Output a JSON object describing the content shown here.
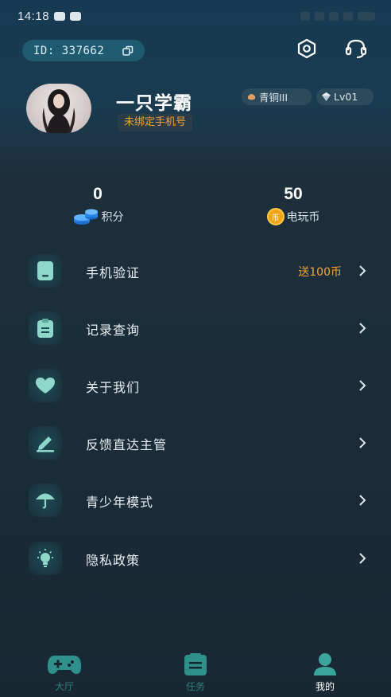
{
  "status_bar": {
    "time": "14:18"
  },
  "header": {
    "id_label": "ID: 337662"
  },
  "profile": {
    "username": "一只学霸",
    "phone_status": "未绑定手机号",
    "rank": "青铜III",
    "level": "Lv01"
  },
  "stats": {
    "points": {
      "value": "0",
      "label": "积分"
    },
    "coins": {
      "value": "50",
      "label": "电玩币",
      "coin_glyph": "币"
    }
  },
  "menu": [
    {
      "label": "手机验证",
      "note": "送100币",
      "icon": "phone-icon"
    },
    {
      "label": "记录查询",
      "note": "",
      "icon": "clipboard-icon"
    },
    {
      "label": "关于我们",
      "note": "",
      "icon": "heart-icon"
    },
    {
      "label": "反馈直达主管",
      "note": "",
      "icon": "pencil-icon"
    },
    {
      "label": "青少年模式",
      "note": "",
      "icon": "umbrella-icon"
    },
    {
      "label": "隐私政策",
      "note": "",
      "icon": "lightbulb-icon"
    }
  ],
  "bottom_nav": [
    {
      "label": "大厅",
      "icon": "gamepad-icon",
      "active": false
    },
    {
      "label": "任务",
      "icon": "task-list-icon",
      "active": false
    },
    {
      "label": "我的",
      "icon": "user-icon",
      "active": true
    }
  ],
  "colors": {
    "accent_teal": "#2f8f8a",
    "highlight_orange": "#f1a33a",
    "background": "#1a2d39"
  }
}
